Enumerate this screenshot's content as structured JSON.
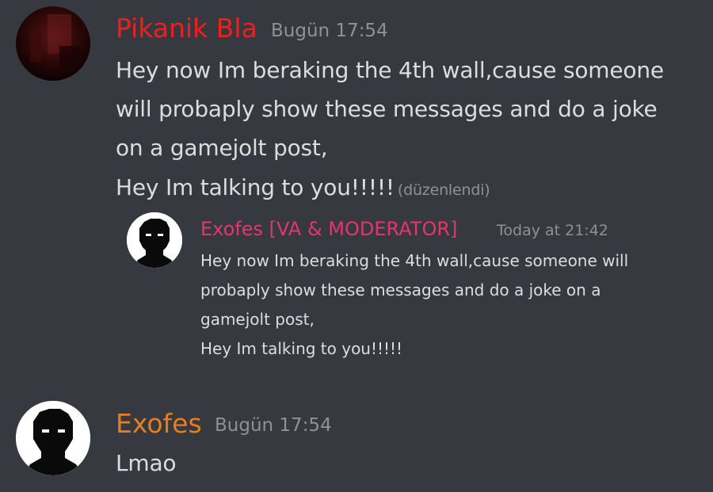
{
  "colors": {
    "background": "#36393f",
    "author_red": "#f21d1d",
    "author_pink": "#e2376b",
    "author_orange": "#e67e22",
    "timestamp": "#8e9297",
    "text": "#dcddde"
  },
  "messages": [
    {
      "author": "Pikanik Bla",
      "timestamp": "Bugün 17:54",
      "lines": [
        "Hey now Im beraking the 4th wall,cause someone",
        "will probaply show these messages and do a joke",
        "on a gamejolt post,",
        "Hey Im talking to you!!!!!"
      ],
      "edited": "(düzenlendi)",
      "embed": {
        "author": "Exofes [VA & MODERATOR]",
        "timestamp": "Today at 21:42",
        "lines": [
          "Hey now Im beraking the 4th wall,cause someone will",
          "probaply show these messages and do a joke on a",
          "gamejolt post,",
          "Hey Im talking to you!!!!!"
        ]
      }
    },
    {
      "author": "Exofes",
      "timestamp": "Bugün 17:54",
      "lines": [
        "Lmao"
      ]
    }
  ]
}
